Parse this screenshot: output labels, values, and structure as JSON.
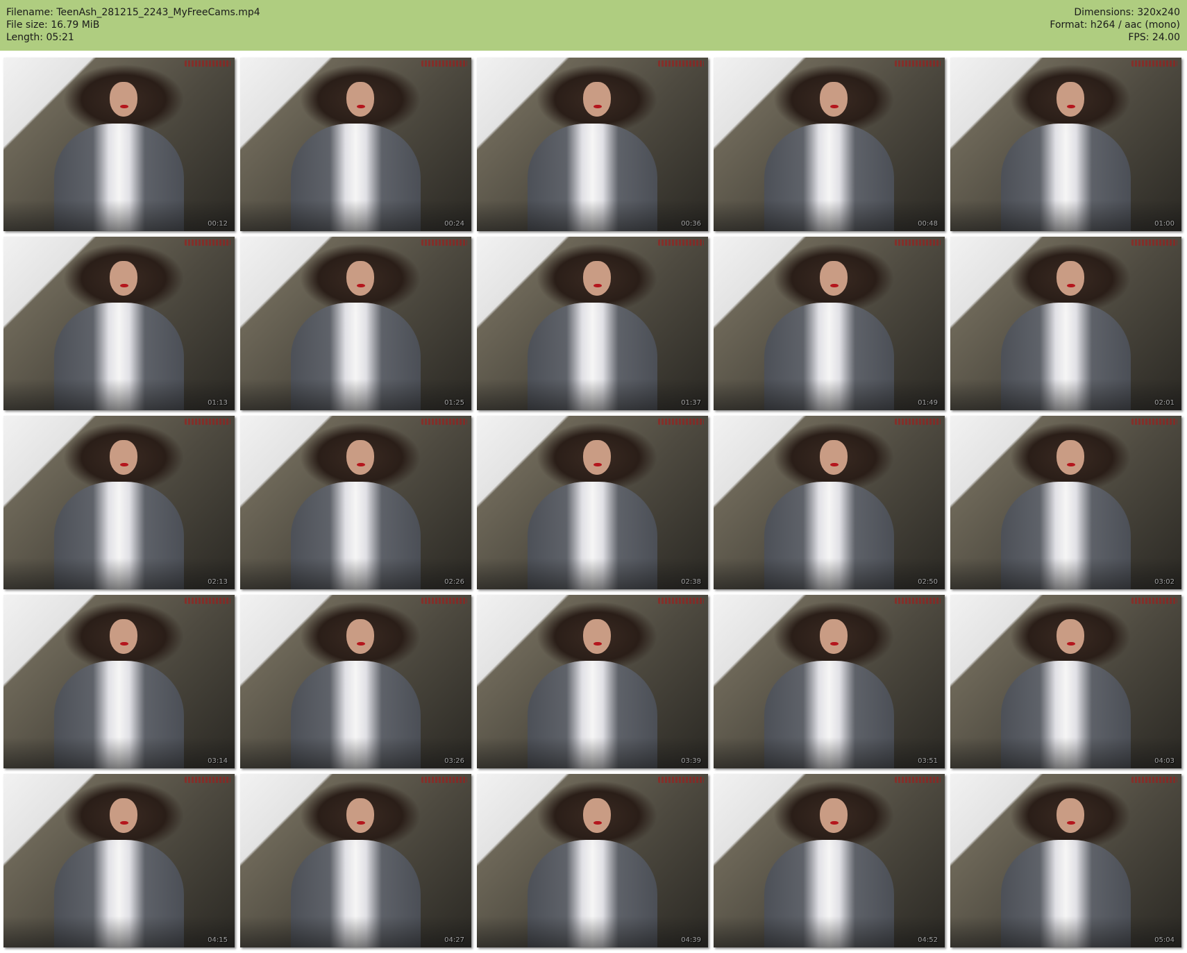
{
  "header": {
    "left": [
      {
        "label": "Filename:",
        "value": "TeenAsh_281215_2243_MyFreeCams.mp4"
      },
      {
        "label": "File size:",
        "value": "16.79 MiB"
      },
      {
        "label": "Length:",
        "value": "05:21"
      }
    ],
    "right": [
      {
        "label": "Dimensions:",
        "value": "320x240"
      },
      {
        "label": "Format:",
        "value": "h264 / aac (mono)"
      },
      {
        "label": "FPS:",
        "value": "24.00"
      }
    ],
    "background_color": "#afcd80"
  },
  "thumbnails": [
    {
      "timestamp": "00:12"
    },
    {
      "timestamp": "00:24"
    },
    {
      "timestamp": "00:36"
    },
    {
      "timestamp": "00:48"
    },
    {
      "timestamp": "01:00"
    },
    {
      "timestamp": "01:13"
    },
    {
      "timestamp": "01:25"
    },
    {
      "timestamp": "01:37"
    },
    {
      "timestamp": "01:49"
    },
    {
      "timestamp": "02:01"
    },
    {
      "timestamp": "02:13"
    },
    {
      "timestamp": "02:26"
    },
    {
      "timestamp": "02:38"
    },
    {
      "timestamp": "02:50"
    },
    {
      "timestamp": "03:02"
    },
    {
      "timestamp": "03:14"
    },
    {
      "timestamp": "03:26"
    },
    {
      "timestamp": "03:39"
    },
    {
      "timestamp": "03:51"
    },
    {
      "timestamp": "04:03"
    },
    {
      "timestamp": "04:15"
    },
    {
      "timestamp": "04:27"
    },
    {
      "timestamp": "04:39"
    },
    {
      "timestamp": "04:52"
    },
    {
      "timestamp": "05:04"
    }
  ]
}
